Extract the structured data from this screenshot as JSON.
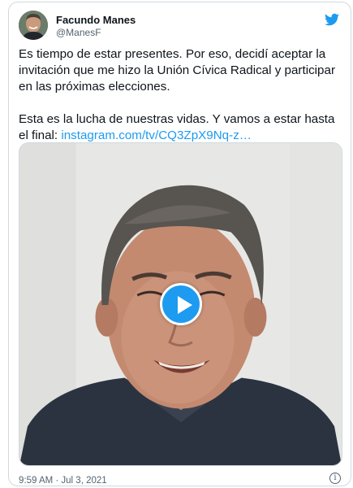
{
  "tweet": {
    "author_name": "Facundo Manes",
    "author_handle": "@ManesF",
    "paragraph_1": "Es tiempo de estar presentes. Por eso, decidí aceptar la invitación que me hizo la Unión Cívica Radical y participar en las próximas elecciones.",
    "paragraph_2_text": "Esta es la lucha de nuestras vidas. Y vamos a estar hasta el final: ",
    "link_text": "instagram.com/tv/CQ3ZpX9Nq-z…",
    "timestamp": "9:59 AM · Jul 3, 2021"
  },
  "icons": {
    "brand": "twitter-bird-icon",
    "play": "play-icon",
    "info": "info-icon"
  },
  "colors": {
    "accent": "#1d9bf0",
    "text": "#0f1419",
    "secondary": "#536471",
    "border": "#cfd9de"
  }
}
